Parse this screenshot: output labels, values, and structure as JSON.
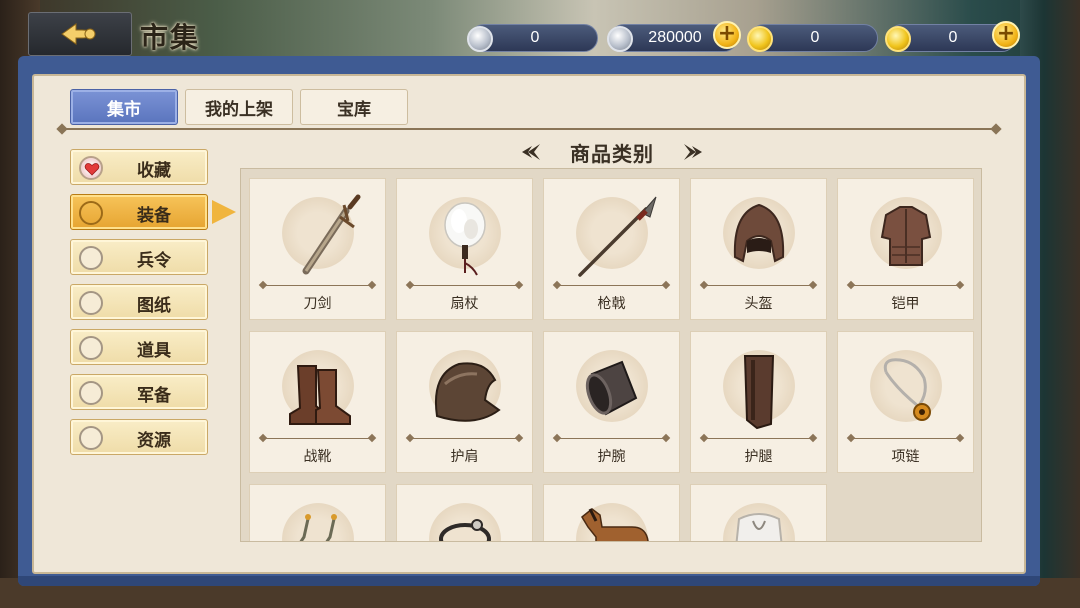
{
  "header": {
    "title": "市集"
  },
  "currencies": [
    {
      "value": "0",
      "coin": "silver-coin-icon",
      "has_plus": false
    },
    {
      "value": "280000",
      "coin": "silver-coin-icon",
      "has_plus": true
    },
    {
      "value": "0",
      "coin": "gold-coin-icon",
      "has_plus": false
    },
    {
      "value": "0",
      "coin": "gold-coin-icon",
      "has_plus": true
    }
  ],
  "tabs": [
    {
      "label": "集市",
      "active": true
    },
    {
      "label": "我的上架",
      "active": false
    },
    {
      "label": "宝库",
      "active": false
    }
  ],
  "side_menu": [
    {
      "label": "收藏",
      "icon": "heart-icon",
      "selected": false
    },
    {
      "label": "装备",
      "selected": true
    },
    {
      "label": "兵令",
      "selected": false
    },
    {
      "label": "图纸",
      "selected": false
    },
    {
      "label": "道具",
      "selected": false
    },
    {
      "label": "军备",
      "selected": false
    },
    {
      "label": "资源",
      "selected": false
    }
  ],
  "category_header": "商品类别",
  "categories": [
    {
      "name": "刀剑",
      "icon": "sword-icon"
    },
    {
      "name": "扇杖",
      "icon": "feather-fan-icon"
    },
    {
      "name": "枪戟",
      "icon": "spear-icon"
    },
    {
      "name": "头盔",
      "icon": "helmet-icon"
    },
    {
      "name": "铠甲",
      "icon": "armor-icon"
    },
    {
      "name": "战靴",
      "icon": "boots-icon"
    },
    {
      "name": "护肩",
      "icon": "shoulder-guard-icon"
    },
    {
      "name": "护腕",
      "icon": "bracer-icon"
    },
    {
      "name": "护腿",
      "icon": "greaves-icon"
    },
    {
      "name": "项链",
      "icon": "necklace-icon"
    },
    {
      "name": "",
      "icon": "earrings-icon"
    },
    {
      "name": "",
      "icon": "ring-icon"
    },
    {
      "name": "",
      "icon": "horse-icon"
    },
    {
      "name": "",
      "icon": "cloak-icon"
    }
  ],
  "colors": {
    "frame_blue": "#3f5b93",
    "active_tab": "#6a82c9",
    "selected_item": "#f0b53e",
    "panel_bg": "#efe7d8"
  }
}
